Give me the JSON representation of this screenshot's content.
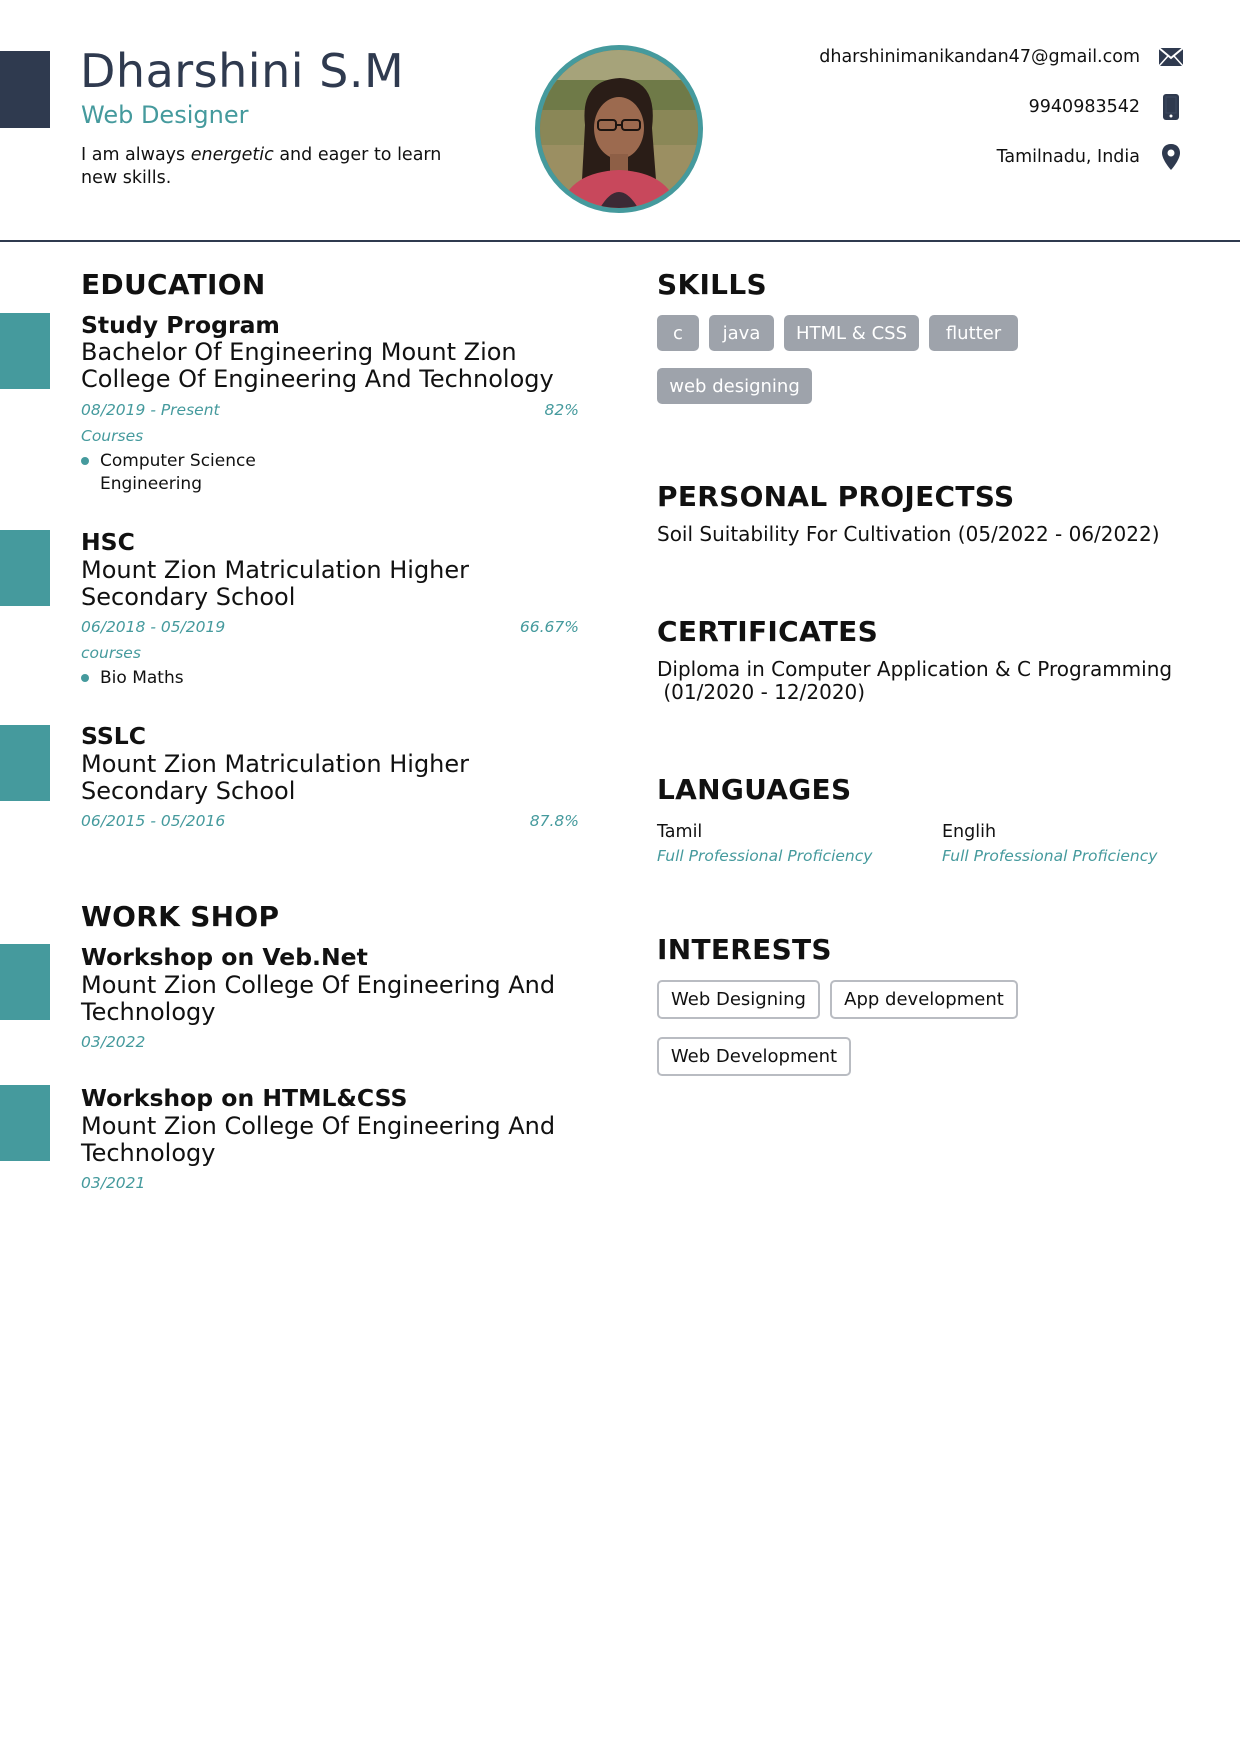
{
  "header": {
    "name": "Dharshini S.M",
    "role": "Web Designer",
    "summary_pre": "I am always ",
    "summary_em": "energetic",
    "summary_post": " and eager to learn new skills."
  },
  "contact": {
    "email": "dharshinimanikandan47@gmail.com",
    "phone": "9940983542",
    "location": "Tamilnadu, India"
  },
  "icons": {
    "email": "envelope-icon",
    "phone": "mobile-phone-icon",
    "location": "map-pin-icon"
  },
  "colors": {
    "accent": "#459a9d",
    "dark": "#2f3a4f",
    "skill_tag": "#9ea3ab"
  },
  "education": {
    "title": "EDUCATION",
    "entries": [
      {
        "title": "Study Program",
        "org": "Bachelor Of Engineering Mount Zion College Of Engineering And Technology",
        "dates": "08/2019 - Present",
        "grade": "82%",
        "courses_label": "Courses",
        "courses": [
          "Computer Science Engineering"
        ]
      },
      {
        "title": "HSC",
        "org": "Mount Zion Matriculation Higher Secondary School",
        "dates": "06/2018 - 05/2019",
        "grade": "66.67%",
        "courses_label": "courses",
        "courses": [
          "Bio Maths"
        ]
      },
      {
        "title": "SSLC",
        "org": "Mount Zion Matriculation Higher Secondary School",
        "dates": "06/2015 - 05/2016",
        "grade": "87.8%"
      }
    ]
  },
  "workshop": {
    "title": "WORK SHOP",
    "entries": [
      {
        "title": "Workshop on Veb.Net",
        "org": "Mount Zion College Of Engineering And Technology",
        "date": "03/2022"
      },
      {
        "title": "Workshop on HTML&CSS",
        "org": "Mount Zion College Of Engineering And Technology",
        "date": "03/2021"
      }
    ]
  },
  "skills": {
    "title": "SKILLS",
    "items": [
      "c",
      "java",
      "HTML & CSS",
      "flutter",
      "web designing"
    ]
  },
  "projects": {
    "title": "PERSONAL PROJECTSS",
    "items": [
      "Soil Suitability For Cultivation (05/2022 - 06/2022)"
    ]
  },
  "certificates": {
    "title": "CERTIFICATES",
    "line1": "Diploma in Computer Application & C Programming",
    "line2": " (01/2020 - 12/2020)"
  },
  "languages": {
    "title": "LANGUAGES",
    "items": [
      {
        "name": "Tamil",
        "level": "Full Professional Proficiency"
      },
      {
        "name": "Englih",
        "level": "Full Professional Proficiency"
      }
    ]
  },
  "interests": {
    "title": "INTERESTS",
    "items": [
      "Web Designing",
      "App development",
      "Web Development"
    ]
  }
}
